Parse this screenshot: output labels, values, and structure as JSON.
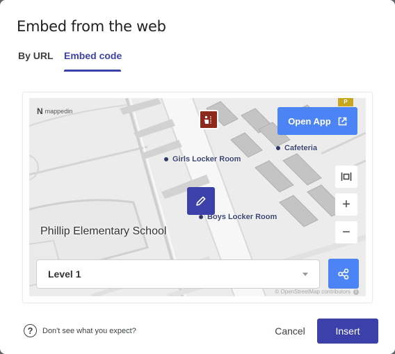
{
  "dialog": {
    "title": "Embed from the web",
    "tabs": [
      {
        "label": "By URL",
        "active": false
      },
      {
        "label": "Embed code",
        "active": true
      }
    ]
  },
  "map": {
    "logo_text": "mappedin",
    "logo_mark": "N",
    "school_name": "Phillip Elementary School",
    "pois": [
      {
        "label": "Girls Locker Room"
      },
      {
        "label": "Cafeteria"
      },
      {
        "label": "Boys Locker Room"
      }
    ],
    "open_app_label": "Open App",
    "level_select": {
      "value": "Level 1"
    },
    "attribution": "© OpenStreetMap contributors",
    "attribution_info": "i",
    "parking_badge": "P",
    "icons": {
      "open_app": "external-link-icon",
      "edit": "pencil-icon",
      "recenter": "fit-bounds-icon",
      "zoom_in": "plus-icon",
      "zoom_out": "minus-icon",
      "share": "share-icon",
      "restroom": "restroom-icon",
      "parking": "parking-icon"
    },
    "zoom_in_label": "+",
    "zoom_out_label": "−",
    "colors": {
      "primary_blue": "#4c84f5",
      "accent_indigo": "#3c40a9",
      "restroom_red": "#8c2a1c",
      "parking_yellow": "#c9a620"
    }
  },
  "footer": {
    "help_text": "Don't see what you expect?",
    "help_icon": "?",
    "cancel_label": "Cancel",
    "insert_label": "Insert"
  }
}
